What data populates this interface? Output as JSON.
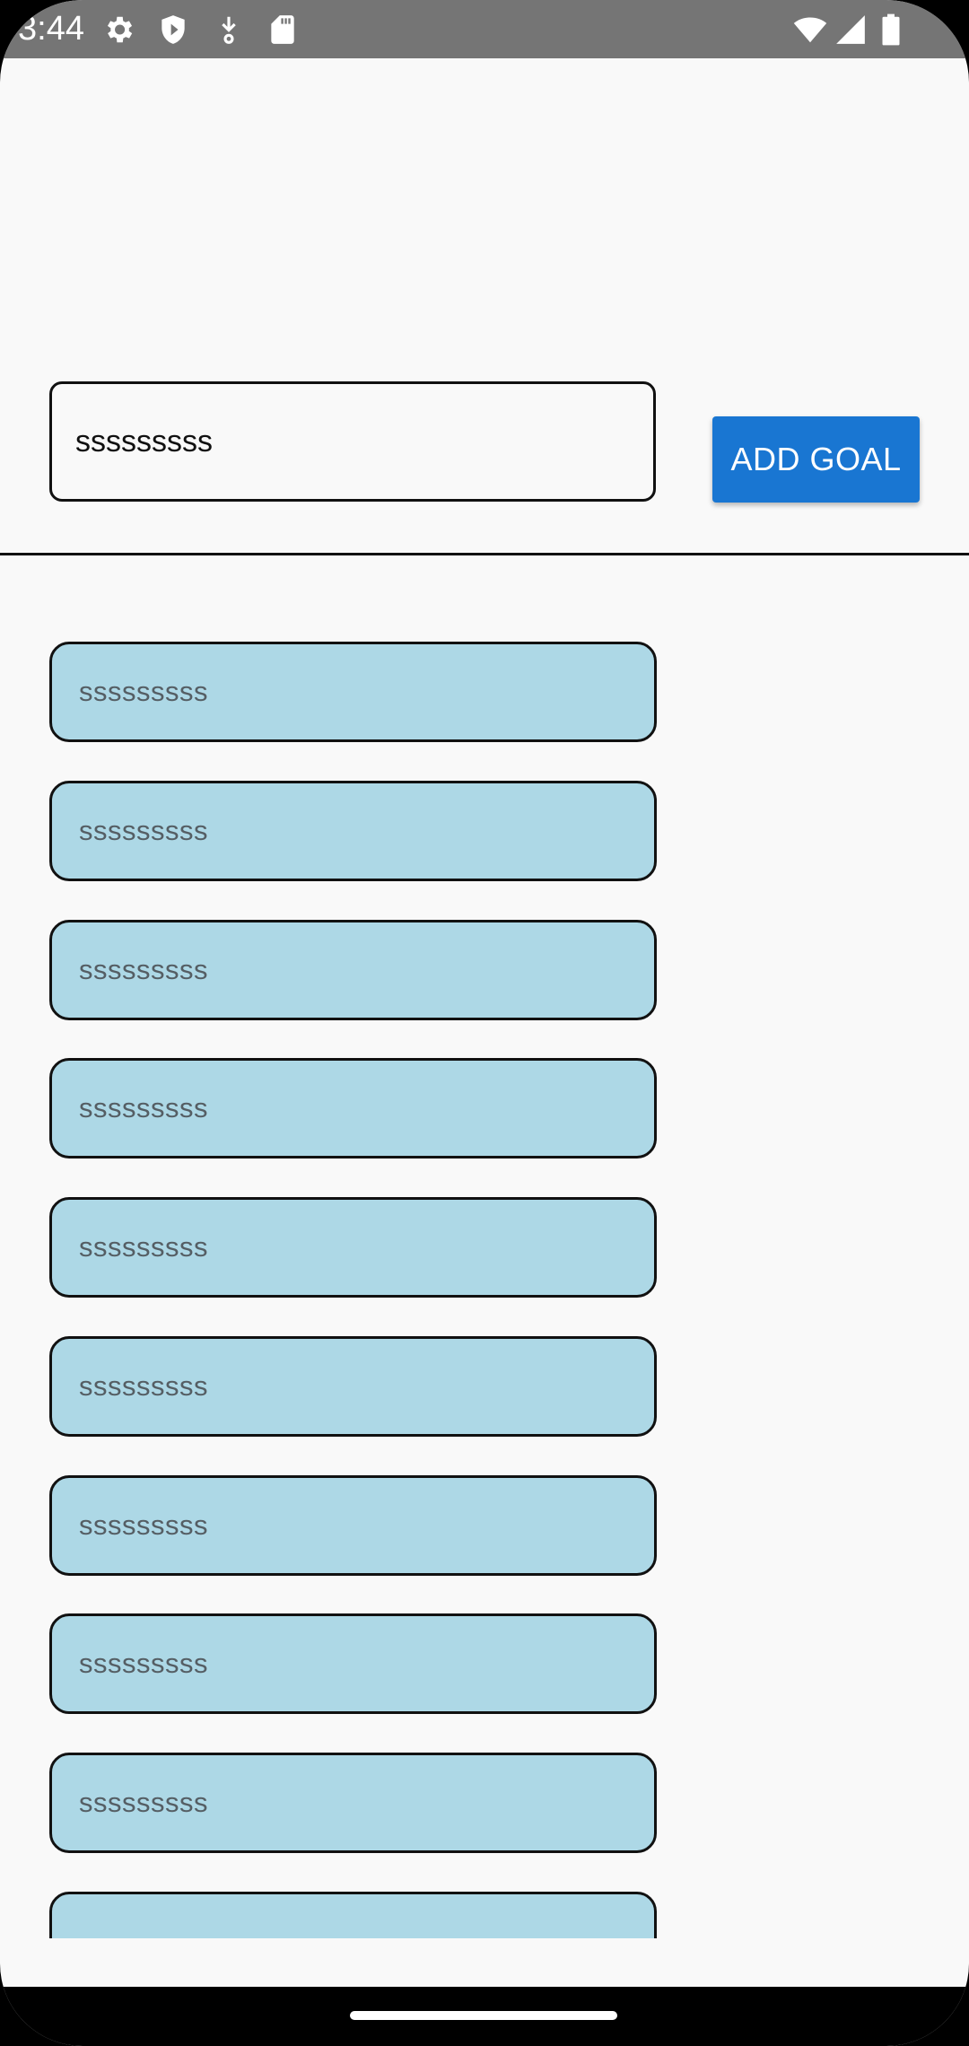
{
  "status_bar": {
    "time": "3:44",
    "left_icons": [
      "gear-icon",
      "shield-icon",
      "download-icon",
      "sd-card-icon"
    ],
    "right_icons": [
      "wifi-icon",
      "signal-icon",
      "battery-icon"
    ]
  },
  "goal_input": {
    "value": "sssssssss",
    "placeholder": ""
  },
  "add_button": {
    "label": "ADD GOAL"
  },
  "goals": [
    {
      "text": "sssssssss"
    },
    {
      "text": "sssssssss"
    },
    {
      "text": "sssssssss"
    },
    {
      "text": "sssssssss"
    },
    {
      "text": "sssssssss"
    },
    {
      "text": "sssssssss"
    },
    {
      "text": "sssssssss"
    },
    {
      "text": "sssssssss"
    },
    {
      "text": "sssssssss"
    },
    {
      "text": ""
    }
  ],
  "colors": {
    "accent": "#1976d2",
    "goal_item_bg": "#add8e6",
    "status_bar_bg": "#757575",
    "background": "#f9f9f9"
  }
}
